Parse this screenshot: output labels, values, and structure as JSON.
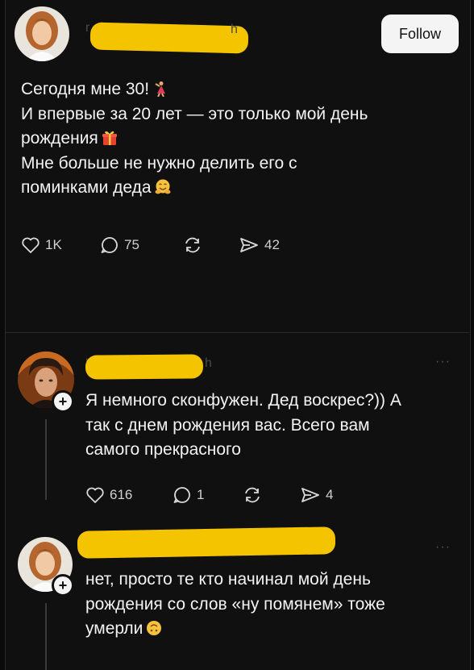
{
  "post": {
    "lines": [
      "Сегодня мне 30!",
      "И впервые за 20 лет — это только мой день",
      "рождения",
      "Мне больше не нужно делить его с",
      "поминками деда"
    ],
    "emojis": [
      "dancer-emoji",
      "gift-emoji",
      "hugging-face-emoji"
    ],
    "follow_label": "Follow",
    "likes": "1K",
    "replies": "75",
    "shares": "42"
  },
  "reply1": {
    "lines": [
      "Я немного сконфужен. Дед воскрес?)) А",
      "так с днем рождения вас. Всего вам",
      "самого прекрасного"
    ],
    "likes": "616",
    "replies": "1",
    "shares": "4"
  },
  "reply2": {
    "lines": [
      "нет, просто те кто начинал мой день",
      "рождения со слов «ну помянем» тоже",
      "умерли"
    ],
    "emojis": [
      "upside-down-face-emoji"
    ]
  },
  "colors": {
    "background": "#101010",
    "text": "#f3f3f3",
    "redaction": "#f5c400",
    "follow_bg": "#f4f4f4"
  }
}
